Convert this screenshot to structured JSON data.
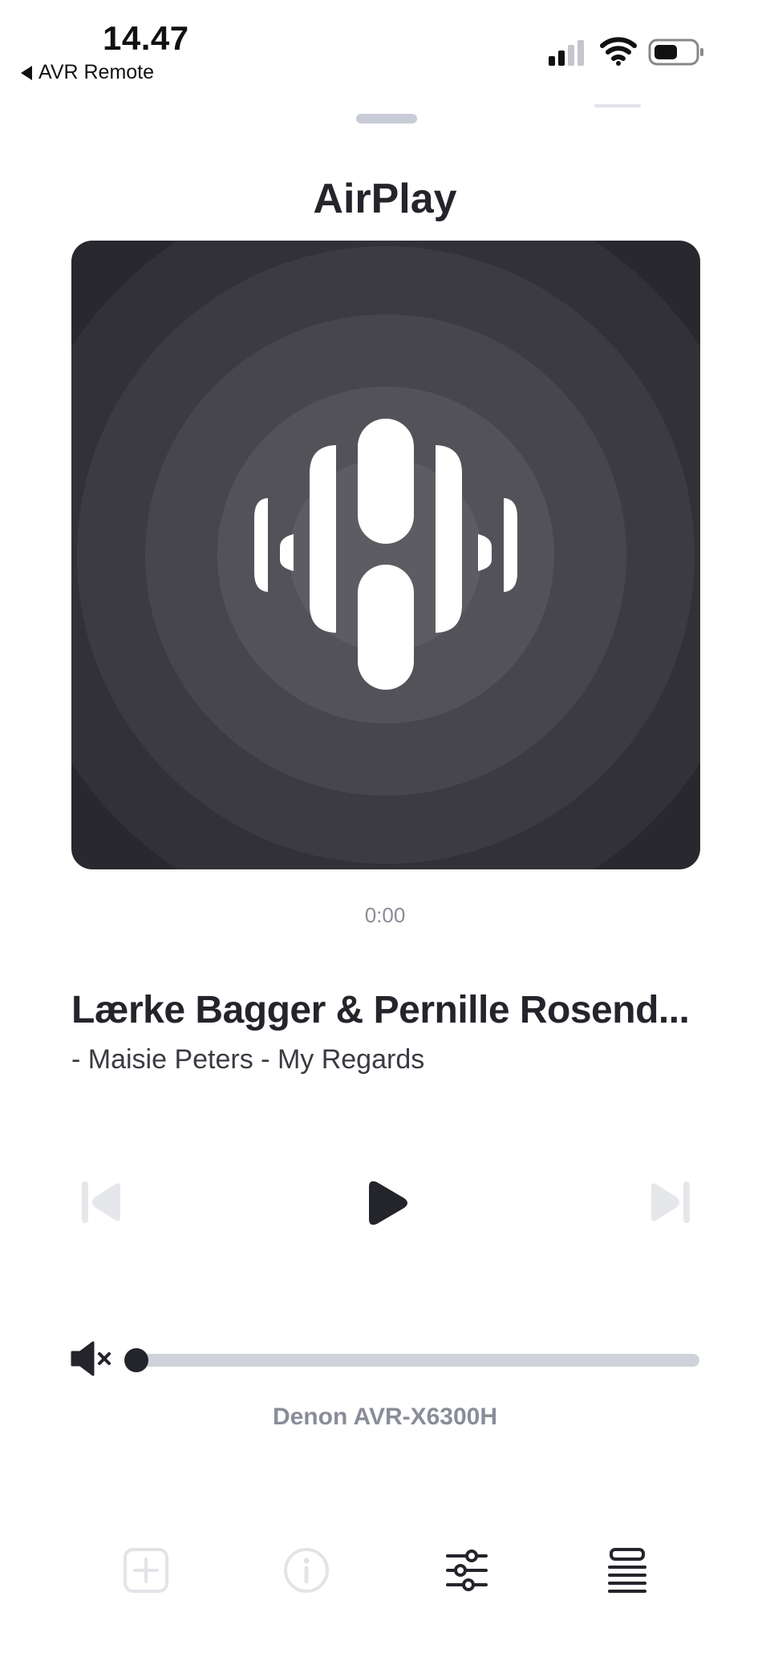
{
  "status_bar": {
    "time": "14.47",
    "back_label": "AVR Remote"
  },
  "now_playing": {
    "source_title": "AirPlay",
    "elapsed": "0:00",
    "title": "Lærke Bagger & Pernille Rosend...",
    "subtitle": "- Maisie Peters - My Regards",
    "device": "Denon AVR-X6300H",
    "volume_fraction": 0.0,
    "muted": true
  },
  "icons": {
    "back": "back-arrow-icon",
    "signal": "cellular-signal-icon",
    "wifi": "wifi-icon",
    "battery": "battery-icon",
    "artwork": "airplay-waveform-icon",
    "previous": "skip-previous-icon",
    "play": "play-icon",
    "next": "skip-next-icon",
    "mute": "speaker-muted-icon",
    "add": "add-square-icon",
    "info": "info-circle-icon",
    "equalizer": "sliders-icon",
    "queue": "list-stack-icon"
  },
  "colors": {
    "text_primary": "#24242b",
    "text_secondary": "#8a8d96",
    "track": "#cfd2da",
    "disabled": "#e6e7ea",
    "artwork_bg": "#3b3b41"
  }
}
